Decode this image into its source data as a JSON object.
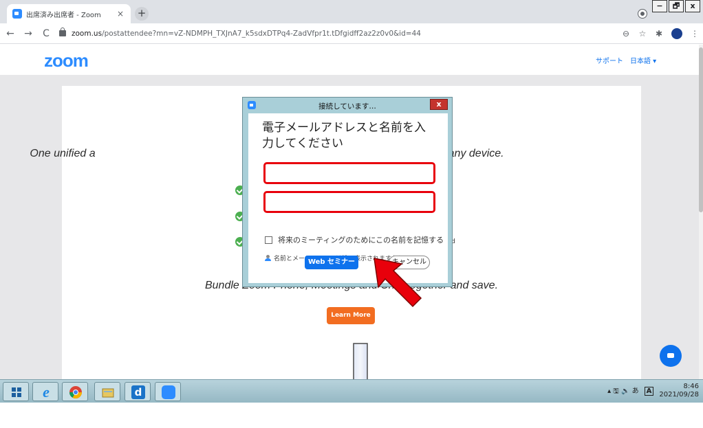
{
  "browser": {
    "tab_title": "出席済み出席者 - Zoom",
    "tab_close": "×",
    "new_tab": "+",
    "url_host": "zoom.us",
    "url_path": "/postattendee?mn=vZ-NDMPH_TXJnA7_k5sdxDTPq4-ZadVfpr1t.tDfgidff2az2z0v0&id=44",
    "back": "←",
    "forward": "→",
    "reload": "C",
    "zoom_icon_label": "⊖",
    "bookmark_star": "☆",
    "extensions": "✱",
    "menu": "⋮",
    "window_controls": {
      "minimize": "−",
      "restore": "🗗",
      "close": "x"
    }
  },
  "site": {
    "logo": "zoom",
    "nav_support": "サポート",
    "nav_language": "日本語 ▾",
    "hero_left": "One unified a",
    "hero_right": "on any device.",
    "feature_fragment": "d",
    "bundle_text": "Bundle Zoom Phone, Meetings and Chat together and save.",
    "learn_more": "Learn More"
  },
  "dialog": {
    "title": "接続しています…",
    "close": "x",
    "heading": "電子メールアドレスと名前を入力してください",
    "email_value": "",
    "name_value": "",
    "remember_label": "将来のミーティングのためにこの名前を記憶する",
    "remember_checked": false,
    "who_sees_label": "名前とメールアドレスは誰に表示されますか？",
    "join_button": "Web セミナーに参加",
    "cancel_button": "キャンセル"
  },
  "taskbar": {
    "items": [
      "start-button",
      "internet-explorer",
      "chrome",
      "file-explorer",
      "d-app",
      "zoom-app"
    ],
    "tray_icons": "▴ 🖫 🔈 あ",
    "ime": "A",
    "time": "8:46",
    "date": "2021/09/28"
  },
  "colors": {
    "zoom_blue": "#2d8cff",
    "highlight_red": "#e8000b",
    "learn_more_orange": "#f26d21",
    "dialog_frame": "#a9cfd8"
  }
}
